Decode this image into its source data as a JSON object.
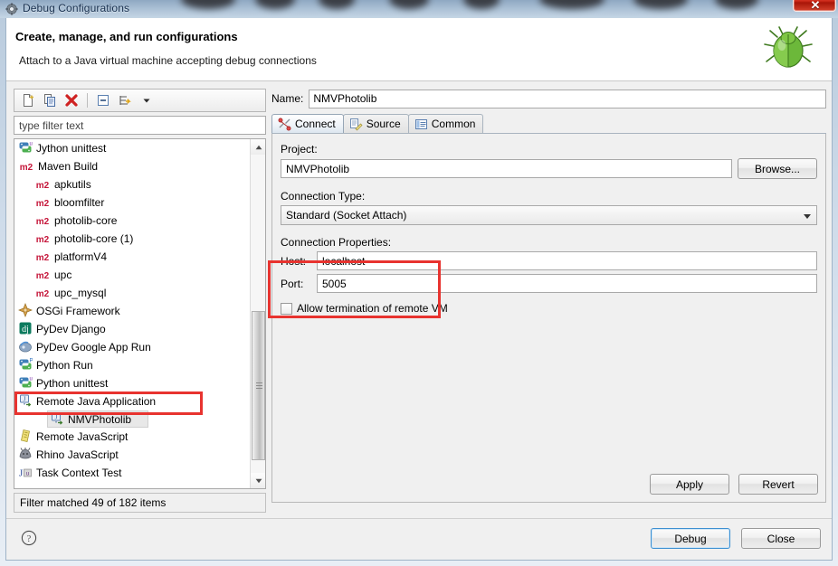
{
  "window": {
    "title": "Debug Configurations",
    "title_icon": "gear-icon",
    "close_label": "✕"
  },
  "header": {
    "title": "Create, manage, and run configurations",
    "subtitle": "Attach to a Java virtual machine accepting debug connections",
    "icon": "green-bug-icon"
  },
  "toolbar": {
    "buttons": [
      {
        "name": "new-configuration",
        "icon": "new-document-icon"
      },
      {
        "name": "duplicate-configuration",
        "icon": "copy-icon"
      },
      {
        "name": "delete-configuration",
        "icon": "red-x-icon"
      },
      {
        "name": "collapse-all",
        "icon": "collapse-all-icon"
      },
      {
        "name": "filter-menu",
        "icon": "filter-arrow-icon"
      },
      {
        "name": "view-menu",
        "icon": "chevron-down-icon"
      }
    ]
  },
  "filter": {
    "placeholder": "type filter text",
    "value": "",
    "status": "Filter matched 49 of 182 items"
  },
  "tree": {
    "items": [
      {
        "label": "Jython unittest",
        "icon": "python-unittest-icon",
        "indent": 0,
        "selected": false
      },
      {
        "label": "Maven Build",
        "icon": "m2-icon",
        "indent": 0,
        "selected": false
      },
      {
        "label": "apkutils",
        "icon": "m2-icon",
        "indent": 1,
        "selected": false
      },
      {
        "label": "bloomfilter",
        "icon": "m2-icon",
        "indent": 1,
        "selected": false
      },
      {
        "label": "photolib-core",
        "icon": "m2-icon",
        "indent": 1,
        "selected": false
      },
      {
        "label": "photolib-core (1)",
        "icon": "m2-icon",
        "indent": 1,
        "selected": false
      },
      {
        "label": "platformV4",
        "icon": "m2-icon",
        "indent": 1,
        "selected": false
      },
      {
        "label": "upc",
        "icon": "m2-icon",
        "indent": 1,
        "selected": false
      },
      {
        "label": "upc_mysql",
        "icon": "m2-icon",
        "indent": 1,
        "selected": false
      },
      {
        "label": "OSGi Framework",
        "icon": "osgi-icon",
        "indent": 0,
        "selected": false
      },
      {
        "label": "PyDev Django",
        "icon": "django-icon",
        "indent": 0,
        "selected": false
      },
      {
        "label": "PyDev Google App Run",
        "icon": "google-app-icon",
        "indent": 0,
        "selected": false
      },
      {
        "label": "Python Run",
        "icon": "python-run-icon",
        "indent": 0,
        "selected": false
      },
      {
        "label": "Python unittest",
        "icon": "python-unittest-icon",
        "indent": 0,
        "selected": false
      },
      {
        "label": "Remote Java Application",
        "icon": "remote-java-icon",
        "indent": 0,
        "selected": false
      },
      {
        "label": "NMVPhotolib",
        "icon": "remote-java-icon",
        "indent": 1,
        "selected": true
      },
      {
        "label": "Remote JavaScript",
        "icon": "remote-js-icon",
        "indent": 0,
        "selected": false
      },
      {
        "label": "Rhino JavaScript",
        "icon": "rhino-icon",
        "indent": 0,
        "selected": false
      },
      {
        "label": "Task Context Test",
        "icon": "junit-icon",
        "indent": 0,
        "selected": false
      }
    ]
  },
  "config": {
    "name_label": "Name:",
    "name_value": "NMVPhotolib",
    "tabs": [
      {
        "label": "Connect",
        "icon": "connect-icon",
        "active": true
      },
      {
        "label": "Source",
        "icon": "source-icon",
        "active": false
      },
      {
        "label": "Common",
        "icon": "common-icon",
        "active": false
      }
    ],
    "project_label": "Project:",
    "project_value": "NMVPhotolib",
    "browse_label": "Browse...",
    "connection_type_label": "Connection Type:",
    "connection_type_value": "Standard (Socket Attach)",
    "connection_properties_label": "Connection Properties:",
    "host_label": "Host:",
    "host_value": "localhost",
    "port_label": "Port:",
    "port_value": "5005",
    "allow_termination_label": "Allow termination of remote VM",
    "allow_termination_checked": false,
    "apply_label": "Apply",
    "revert_label": "Revert"
  },
  "footer": {
    "help_icon": "question-mark-icon",
    "debug_label": "Debug",
    "close_label": "Close"
  },
  "colors": {
    "annotation": "#e8332f",
    "maven_red": "#c5163a",
    "title_blue": "#18304f",
    "default_button_border": "#3c8fd1"
  }
}
